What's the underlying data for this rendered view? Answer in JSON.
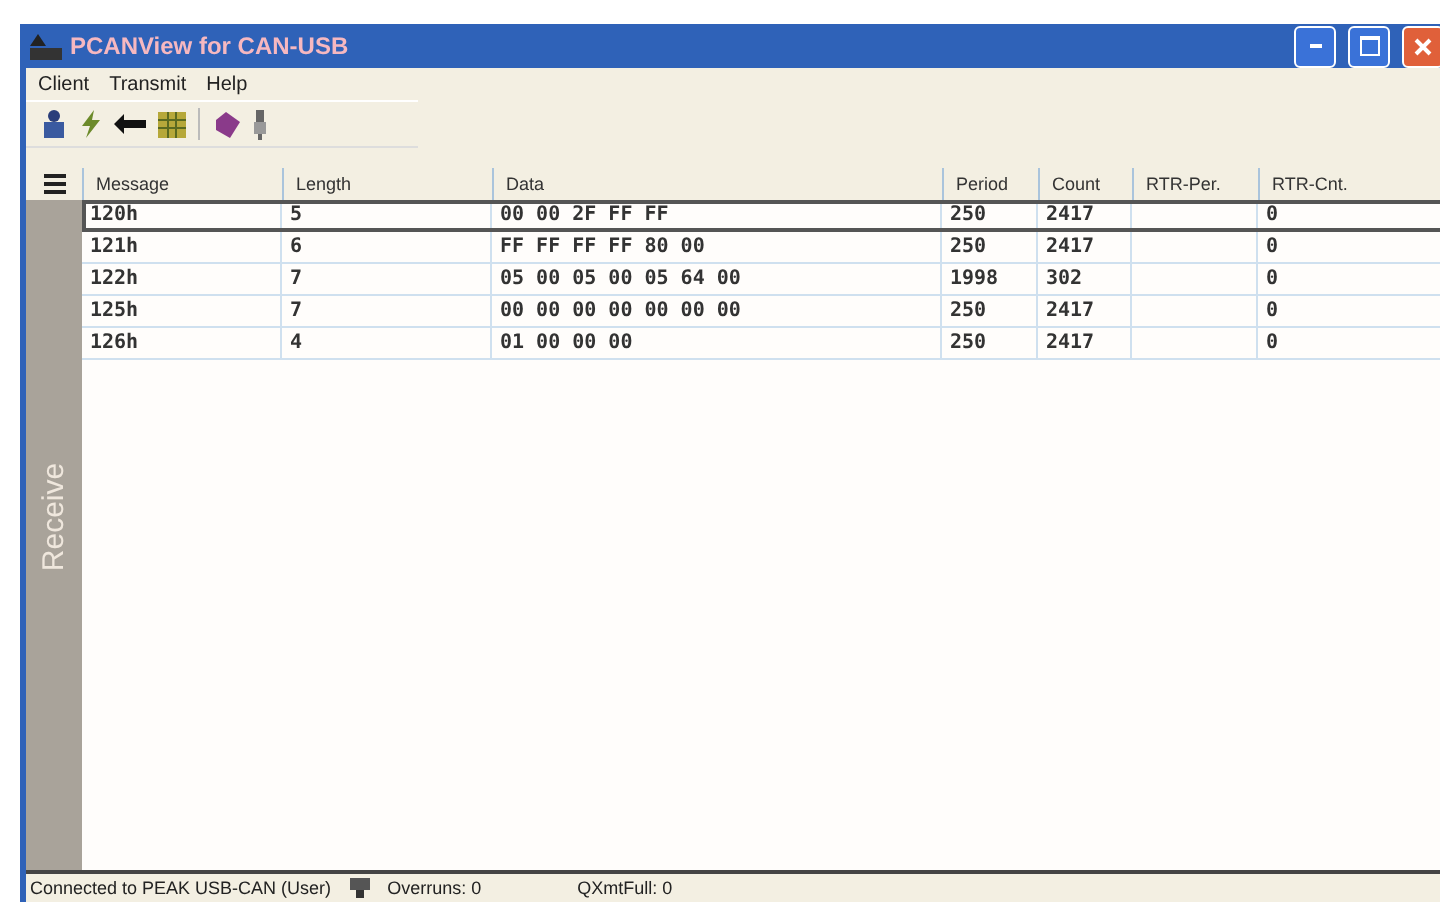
{
  "window": {
    "title": "PCANView for CAN-USB"
  },
  "menu": [
    "Client",
    "Transmit",
    "Help"
  ],
  "toolbar": [
    {
      "kind": "person"
    },
    {
      "kind": "bolt"
    },
    {
      "kind": "arrow"
    },
    {
      "kind": "grid"
    },
    {
      "kind": "sep"
    },
    {
      "kind": "gem"
    },
    {
      "kind": "plug"
    }
  ],
  "panel": {
    "label": "Receive"
  },
  "table": {
    "columns": [
      "Message",
      "Length",
      "Data",
      "Period",
      "Count",
      "RTR-Per.",
      "RTR-Cnt."
    ],
    "rows": [
      {
        "selected": true,
        "cells": [
          "120h",
          "5",
          "00 00 2F FF FF",
          "250",
          "2417",
          "",
          "0"
        ]
      },
      {
        "selected": false,
        "cells": [
          "121h",
          "6",
          "FF FF FF FF 80 00",
          "250",
          "2417",
          "",
          "0"
        ]
      },
      {
        "selected": false,
        "cells": [
          "122h",
          "7",
          "05 00 05 00 05 64 00",
          "1998",
          "302",
          "",
          "0"
        ]
      },
      {
        "selected": false,
        "cells": [
          "125h",
          "7",
          "00 00 00 00 00 00 00",
          "250",
          "2417",
          "",
          "0"
        ]
      },
      {
        "selected": false,
        "cells": [
          "126h",
          "4",
          "01 00 00 00",
          "250",
          "2417",
          "",
          "0"
        ]
      }
    ]
  },
  "status_bar": {
    "connection": "Connected to PEAK USB-CAN (User)",
    "overruns": "Overruns: 0",
    "qxmtfull": "QXmtFull: 0"
  }
}
